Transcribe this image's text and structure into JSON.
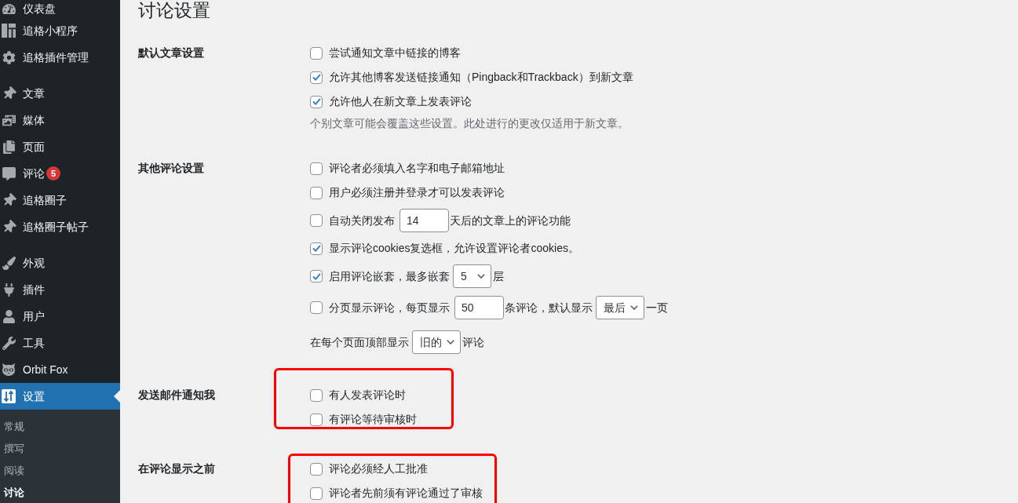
{
  "sidebar": {
    "groups": [
      {
        "items": [
          {
            "label": "仪表盘",
            "selected": false
          },
          {
            "label": "追格小程序",
            "selected": false
          },
          {
            "label": "追格插件管理",
            "selected": false
          }
        ]
      },
      {
        "items": [
          {
            "label": "文章",
            "selected": false
          },
          {
            "label": "媒体",
            "selected": false
          },
          {
            "label": "页面",
            "selected": false
          },
          {
            "label": "评论",
            "selected": false,
            "badge": "5"
          },
          {
            "label": "追格圈子",
            "selected": false
          },
          {
            "label": "追格圈子帖子",
            "selected": false
          }
        ]
      },
      {
        "items": [
          {
            "label": "外观",
            "selected": false
          },
          {
            "label": "插件",
            "selected": false
          },
          {
            "label": "用户",
            "selected": false
          },
          {
            "label": "工具",
            "selected": false
          },
          {
            "label": "Orbit Fox",
            "selected": false
          },
          {
            "label": "设置",
            "selected": true
          }
        ]
      }
    ],
    "submenu": [
      {
        "label": "常规",
        "selected": false
      },
      {
        "label": "撰写",
        "selected": false
      },
      {
        "label": "阅读",
        "selected": false
      },
      {
        "label": "讨论",
        "selected": true
      }
    ]
  },
  "page": {
    "title": "讨论设置"
  },
  "sections": [
    {
      "label": "默认文章设置",
      "highlighted": false,
      "rows": [
        {
          "kind": "checkbox",
          "checked": false,
          "parts": [
            {
              "kind": "text",
              "text": "尝试通知文章中链接的博客"
            }
          ]
        },
        {
          "kind": "checkbox",
          "checked": true,
          "parts": [
            {
              "kind": "text",
              "text": "允许其他博客发送链接通知（Pingback和Trackback）到新文章"
            }
          ]
        },
        {
          "kind": "checkbox",
          "checked": true,
          "parts": [
            {
              "kind": "text",
              "text": "允许他人在新文章上发表评论"
            }
          ]
        }
      ],
      "description": "个别文章可能会覆盖这些设置。此处进行的更改仅适用于新文章。"
    },
    {
      "label": "其他评论设置",
      "highlighted": false,
      "rows": [
        {
          "kind": "checkbox",
          "checked": false,
          "parts": [
            {
              "kind": "text",
              "text": "评论者必须填入名字和电子邮箱地址"
            }
          ]
        },
        {
          "kind": "checkbox",
          "checked": false,
          "parts": [
            {
              "kind": "text",
              "text": "用户必须注册并登录才可以发表评论"
            }
          ]
        },
        {
          "kind": "checkbox",
          "checked": false,
          "parts": [
            {
              "kind": "text",
              "text": "自动关闭发布"
            },
            {
              "kind": "input",
              "value": "14"
            },
            {
              "kind": "text",
              "text": "天后的文章上的评论功能"
            }
          ]
        },
        {
          "kind": "checkbox",
          "checked": true,
          "parts": [
            {
              "kind": "text",
              "text": "显示评论cookies复选框，允许设置评论者cookies。"
            }
          ]
        },
        {
          "kind": "checkbox",
          "checked": true,
          "parts": [
            {
              "kind": "text",
              "text": "启用评论嵌套，最多嵌套"
            },
            {
              "kind": "select",
              "value": "5"
            },
            {
              "kind": "text",
              "text": "层"
            }
          ]
        },
        {
          "kind": "checkbox",
          "checked": false,
          "parts": [
            {
              "kind": "text",
              "text": "分页显示评论，每页显示"
            },
            {
              "kind": "input",
              "value": "50"
            },
            {
              "kind": "text",
              "text": "条评论，默认显示"
            },
            {
              "kind": "select",
              "value": "最后"
            },
            {
              "kind": "text",
              "text": "一页"
            }
          ]
        },
        {
          "kind": "plain",
          "parts": [
            {
              "kind": "text",
              "text": "在每个页面顶部显示"
            },
            {
              "kind": "select",
              "value": "旧的"
            },
            {
              "kind": "text",
              "text": "评论"
            }
          ]
        }
      ]
    },
    {
      "label": "发送邮件通知我",
      "highlighted": true,
      "rows": [
        {
          "kind": "checkbox",
          "checked": false,
          "parts": [
            {
              "kind": "text",
              "text": "有人发表评论时"
            }
          ]
        },
        {
          "kind": "checkbox",
          "checked": false,
          "parts": [
            {
              "kind": "text",
              "text": "有评论等待审核时"
            }
          ]
        }
      ]
    },
    {
      "label": "在评论显示之前",
      "highlighted": true,
      "rows": [
        {
          "kind": "checkbox",
          "checked": false,
          "parts": [
            {
              "kind": "text",
              "text": "评论必须经人工批准"
            }
          ]
        },
        {
          "kind": "checkbox",
          "checked": false,
          "parts": [
            {
              "kind": "text",
              "text": "评论者先前须有评论通过了审核"
            }
          ]
        }
      ]
    }
  ]
}
